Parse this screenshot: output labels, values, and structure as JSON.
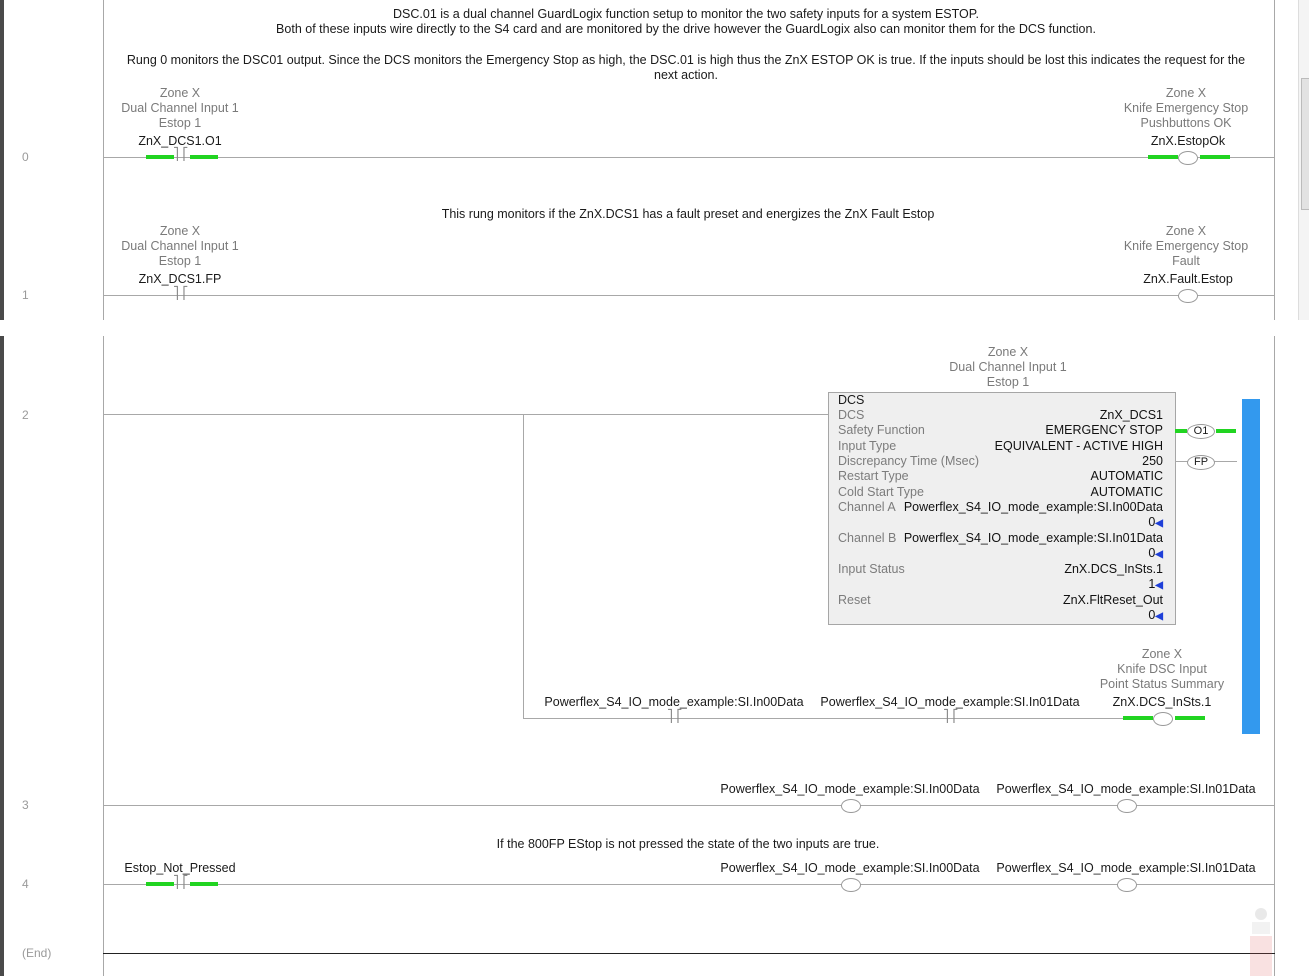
{
  "rungs": {
    "r0": {
      "number": "0",
      "comment1": "DSC.01 is a dual channel GuardLogix function setup to monitor the two safety inputs for a system ESTOP.",
      "comment2": "Both of these inputs wire directly to the S4 card and are monitored by the drive however the GuardLogix also can monitor them for the DCS function.",
      "comment3": "Rung 0 monitors the DSC01 output.  Since the DCS monitors the Emergency Stop as high, the DSC.01 is high thus the ZnX ESTOP OK is true.   If the inputs should be lost this indicates the request for the",
      "comment4": "next action.",
      "contact_desc": [
        "Zone X",
        "Dual Channel Input 1",
        "Estop 1"
      ],
      "contact_tag": "ZnX_DCS1.O1",
      "coil_desc": [
        "Zone X",
        "Knife Emergency Stop",
        "Pushbuttons OK"
      ],
      "coil_tag": "ZnX.EstopOk"
    },
    "r1": {
      "number": "1",
      "comment": "This rung monitors if the ZnX.DCS1 has a fault preset and energizes the ZnX Fault Estop",
      "contact_desc": [
        "Zone X",
        "Dual Channel Input 1",
        "Estop 1"
      ],
      "contact_tag": "ZnX_DCS1.FP",
      "coil_desc": [
        "Zone X",
        "Knife Emergency Stop",
        "Fault"
      ],
      "coil_tag": "ZnX.Fault.Estop"
    },
    "r2": {
      "number": "2",
      "block_desc": [
        "Zone X",
        "Dual Channel Input 1",
        "Estop 1"
      ],
      "block": {
        "title": "DCS",
        "rows": [
          {
            "label": "DCS",
            "value": "ZnX_DCS1"
          },
          {
            "label": "Safety Function",
            "value": "EMERGENCY STOP"
          },
          {
            "label": "Input Type",
            "value": "EQUIVALENT - ACTIVE HIGH"
          },
          {
            "label": "Discrepancy Time (Msec)",
            "value": "250"
          },
          {
            "label": "Restart Type",
            "value": "AUTOMATIC"
          },
          {
            "label": "Cold Start Type",
            "value": "AUTOMATIC"
          }
        ],
        "channel_a_label": "Channel A",
        "channel_a_tag": "Powerflex_S4_IO_mode_example:SI.In00Data",
        "channel_a_val": "0",
        "channel_b_label": "Channel B",
        "channel_b_tag": "Powerflex_S4_IO_mode_example:SI.In01Data",
        "channel_b_val": "0",
        "input_status_label": "Input Status",
        "input_status_tag": "ZnX.DCS_InSts.1",
        "input_status_val": "1",
        "reset_label": "Reset",
        "reset_tag": "ZnX.FltReset_Out",
        "reset_val": "0",
        "out_o1": "O1",
        "out_fp": "FP"
      },
      "branch_contact1": "Powerflex_S4_IO_mode_example:SI.In00Data",
      "branch_contact2": "Powerflex_S4_IO_mode_example:SI.In01Data",
      "branch_coil_desc": [
        "Zone X",
        "Knife DSC Input",
        "Point Status Summary"
      ],
      "branch_coil_tag": "ZnX.DCS_InSts.1"
    },
    "r3": {
      "number": "3",
      "coil1": "Powerflex_S4_IO_mode_example:SI.In00Data",
      "coil2": "Powerflex_S4_IO_mode_example:SI.In01Data"
    },
    "r4": {
      "number": "4",
      "comment": "If the 800FP EStop is not pressed the state of the two inputs are true.",
      "contact_tag": "Estop_Not_Pressed",
      "coil1": "Powerflex_S4_IO_mode_example:SI.In00Data",
      "coil2": "Powerflex_S4_IO_mode_example:SI.In01Data"
    },
    "end": {
      "label": "(End)"
    }
  },
  "colors": {
    "energized": "#21d421",
    "power_flow": "#3399ee",
    "rail": "#a8a8a8"
  }
}
